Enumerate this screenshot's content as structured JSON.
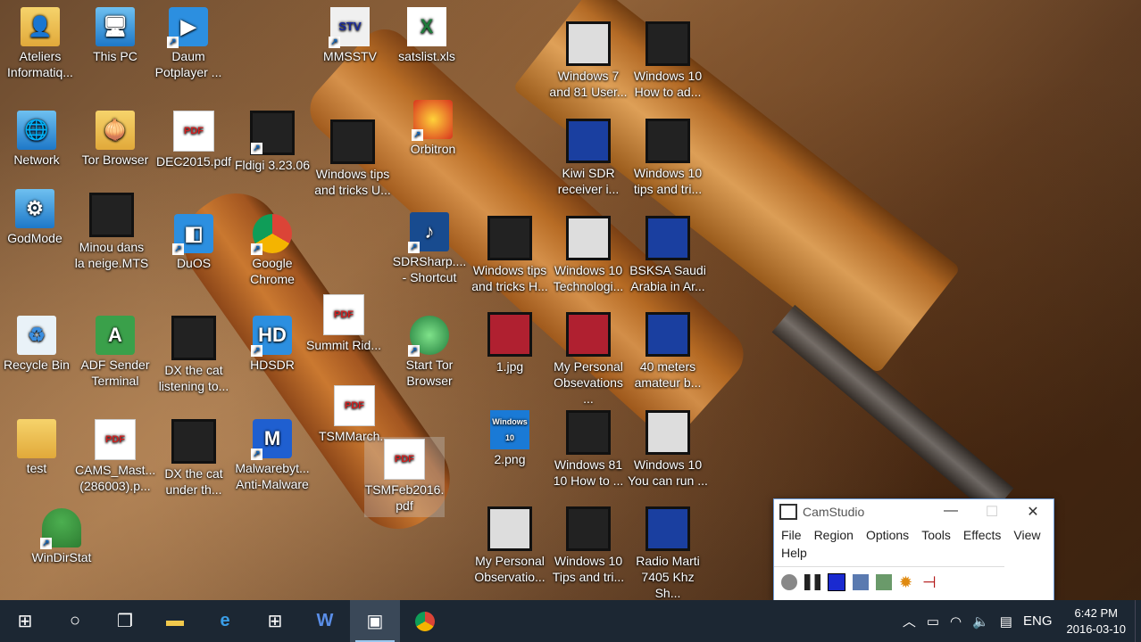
{
  "desktop_icons": [
    {
      "label": "Ateliers\nInformatiq...",
      "icon": "folder-user-icon"
    },
    {
      "label": "This PC",
      "icon": "computer-icon"
    },
    {
      "label": "Daum\nPotplayer ...",
      "icon": "potplayer-icon"
    },
    {
      "label": "MMSSTV",
      "icon": "mmsstv-icon"
    },
    {
      "label": "satslist.xls",
      "icon": "excel-icon"
    },
    {
      "label": "Windows 7\nand 81 User...",
      "icon": "video-icon"
    },
    {
      "label": "Windows 10\nHow to ad...",
      "icon": "video-icon"
    },
    {
      "label": "Network",
      "icon": "network-icon"
    },
    {
      "label": "Tor Browser",
      "icon": "tor-icon"
    },
    {
      "label": "DEC2015.pdf",
      "icon": "pdf-icon"
    },
    {
      "label": "Fldigi 3.23.06",
      "icon": "fldigi-icon"
    },
    {
      "label": "Windows tips\nand tricks U...",
      "icon": "video-icon"
    },
    {
      "label": "Orbitron",
      "icon": "orbitron-icon"
    },
    {
      "label": "Kiwi SDR\nreceiver i...",
      "icon": "video-icon"
    },
    {
      "label": "Windows 10\ntips and tri...",
      "icon": "video-icon"
    },
    {
      "label": "GodMode",
      "icon": "control-panel-icon"
    },
    {
      "label": "Minou dans\nla neige.MTS",
      "icon": "video-icon"
    },
    {
      "label": "DuOS",
      "icon": "duos-icon"
    },
    {
      "label": "Google\nChrome",
      "icon": "chrome-icon"
    },
    {
      "label": "SDRSharp....\n- Shortcut",
      "icon": "sdrsharp-icon"
    },
    {
      "label": "Windows tips\nand tricks H...",
      "icon": "video-icon"
    },
    {
      "label": "Windows 10\nTechnologi...",
      "icon": "video-icon"
    },
    {
      "label": "BSKSA Saudi\nArabia in Ar...",
      "icon": "video-icon"
    },
    {
      "label": "Recycle Bin",
      "icon": "recycle-bin-icon"
    },
    {
      "label": "ADF Sender\nTerminal",
      "icon": "adf-icon"
    },
    {
      "label": "DX the cat\nlistening to...",
      "icon": "video-icon"
    },
    {
      "label": "HDSDR",
      "icon": "hdsdr-icon"
    },
    {
      "label": "Summit Rid...",
      "icon": "pdf-icon"
    },
    {
      "label": "Start Tor\nBrowser",
      "icon": "globe-icon"
    },
    {
      "label": "1.jpg",
      "icon": "image-icon"
    },
    {
      "label": "My Personal\nObsevations ...",
      "icon": "video-icon"
    },
    {
      "label": "40 meters\namateur b...",
      "icon": "video-icon"
    },
    {
      "label": "TSMMarch...",
      "icon": "pdf-icon"
    },
    {
      "label": "test",
      "icon": "folder-icon"
    },
    {
      "label": "CAMS_Mast...\n(286003).p...",
      "icon": "pdf-icon"
    },
    {
      "label": "DX the cat\nunder th...",
      "icon": "video-icon"
    },
    {
      "label": "Malwarebyt...\nAnti-Malware",
      "icon": "malwarebytes-icon"
    },
    {
      "label": "TSMFeb2016.\npdf",
      "icon": "pdf-icon"
    },
    {
      "label": "2.png",
      "icon": "image-icon"
    },
    {
      "label": "Windows 81\n10 How to ...",
      "icon": "video-icon"
    },
    {
      "label": "Windows 10\nYou can run ...",
      "icon": "video-icon"
    },
    {
      "label": "WinDirStat",
      "icon": "windirstat-icon"
    },
    {
      "label": "My Personal\nObservatio...",
      "icon": "video-icon"
    },
    {
      "label": "Windows 10\nTips and tri...",
      "icon": "video-icon"
    },
    {
      "label": "Radio Marti\n7405 Khz Sh...",
      "icon": "video-icon"
    }
  ],
  "camstudio": {
    "title": "CamStudio",
    "menu": [
      "File",
      "Region",
      "Options",
      "Tools",
      "Effects",
      "View",
      "Help"
    ]
  },
  "taskbar": {
    "language": "ENG",
    "time": "6:42 PM",
    "date": "2016-03-10"
  }
}
